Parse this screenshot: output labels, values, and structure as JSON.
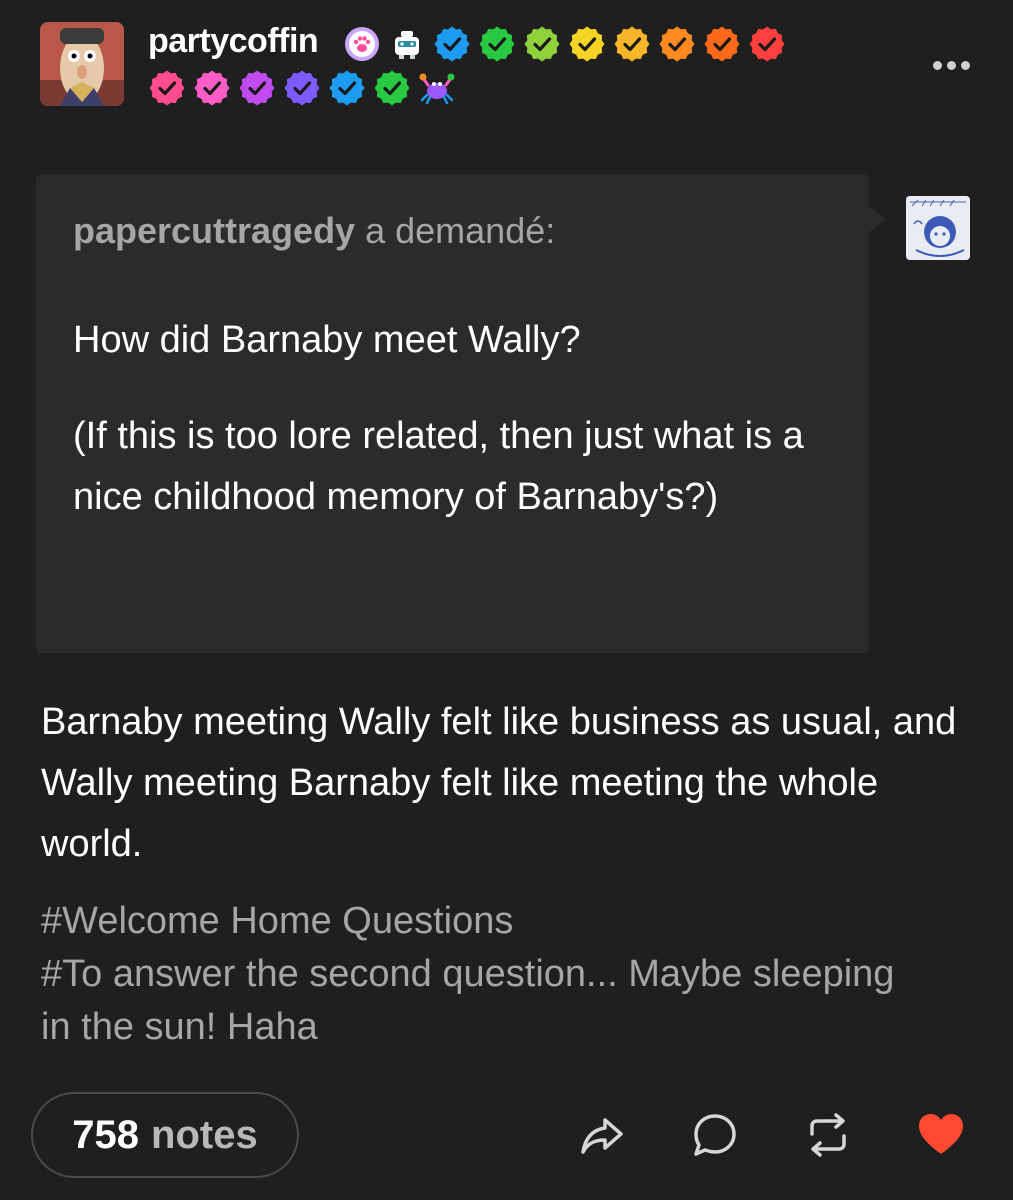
{
  "post": {
    "blog_name": "partycoffin",
    "badges_row1": [
      {
        "icon": "paw-badge-icon",
        "color": "#c9a6ff"
      },
      {
        "icon": "robot-badge-icon",
        "color": "#2a8fa0"
      },
      {
        "icon": "checkmark-badge-icon",
        "color": "#1d9bf0"
      },
      {
        "icon": "checkmark-badge-icon",
        "color": "#28c840"
      },
      {
        "icon": "checkmark-badge-icon",
        "color": "#8ed13b"
      },
      {
        "icon": "checkmark-badge-icon",
        "color": "#f5d425"
      },
      {
        "icon": "checkmark-badge-icon",
        "color": "#f7b52a"
      },
      {
        "icon": "checkmark-badge-icon",
        "color": "#ff8a1f"
      },
      {
        "icon": "checkmark-badge-icon",
        "color": "#ff6a1a"
      },
      {
        "icon": "checkmark-badge-icon",
        "color": "#ff3e3e"
      }
    ],
    "badges_row2": [
      {
        "icon": "checkmark-badge-icon",
        "color": "#ff4d8d"
      },
      {
        "icon": "checkmark-badge-icon",
        "color": "#ff5ec9"
      },
      {
        "icon": "checkmark-badge-icon",
        "color": "#c04cf0"
      },
      {
        "icon": "checkmark-badge-icon",
        "color": "#7d5cff"
      },
      {
        "icon": "checkmark-badge-icon",
        "color": "#1d9bf0"
      },
      {
        "icon": "checkmark-badge-icon",
        "color": "#28c840"
      },
      {
        "icon": "crab-badge-icon",
        "color": "#9b59ff"
      }
    ]
  },
  "ask": {
    "asker": "papercuttragedy",
    "verb": "a demandé:",
    "question_line1": "How did Barnaby meet Wally?",
    "question_line2": "(If this is too lore related, then just what is a nice childhood memory of Barnaby's?)"
  },
  "answer": {
    "text": "Barnaby meeting Wally felt like business as usual, and Wally meeting Barnaby felt like meeting the whole world."
  },
  "tags": [
    "#Welcome Home Questions",
    "#To answer the second question... Maybe sleeping in the sun! Haha"
  ],
  "footer": {
    "notes_count": "758",
    "notes_label": "notes",
    "like_color": "#ff4930"
  }
}
